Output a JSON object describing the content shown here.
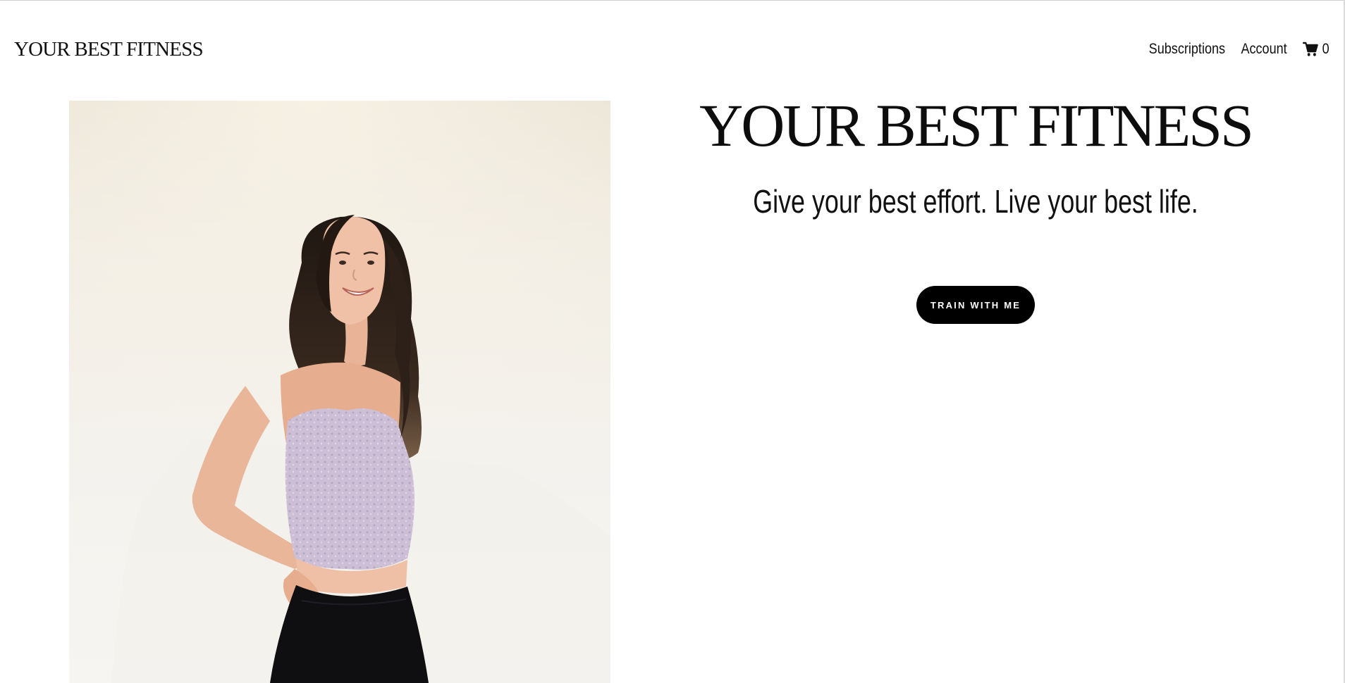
{
  "header": {
    "logo_text": "YOUR BEST FITNESS",
    "nav": {
      "subscriptions_label": "Subscriptions",
      "account_label": "Account",
      "cart_icon": "shopping-cart-icon",
      "cart_count": "0"
    }
  },
  "hero": {
    "image_subject": "woman in lavender crop top smiling",
    "title": "YOUR BEST FITNESS",
    "subtitle": "Give your best effort. Live your best life.",
    "cta_label": "TRAIN WITH ME"
  },
  "colors": {
    "text": "#111111",
    "button_background": "#000000",
    "button_text": "#ffffff",
    "page_background": "#ffffff",
    "photo_backdrop": "#f4f2ed"
  }
}
